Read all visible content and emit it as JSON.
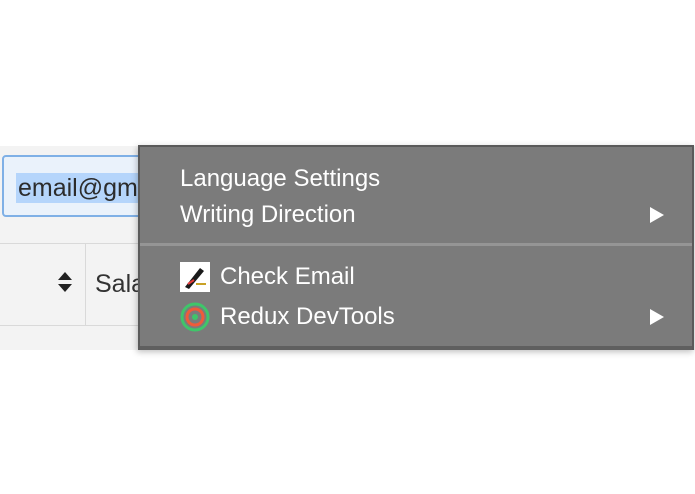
{
  "email_input": {
    "value": "email@gm"
  },
  "table": {
    "column_label": "Sala"
  },
  "context_menu": {
    "items": [
      {
        "label": "Language Settings",
        "has_submenu": false
      },
      {
        "label": "Writing Direction",
        "has_submenu": true
      },
      {
        "label": "Check Email",
        "icon": "check-email-extension-icon",
        "has_submenu": false
      },
      {
        "label": "Redux DevTools",
        "icon": "redux-devtools-icon",
        "has_submenu": true
      }
    ]
  },
  "colors": {
    "menu_background": "#7b7b7b",
    "selection_highlight": "#b5d5fb",
    "input_focus_border": "#7fb0e6"
  }
}
